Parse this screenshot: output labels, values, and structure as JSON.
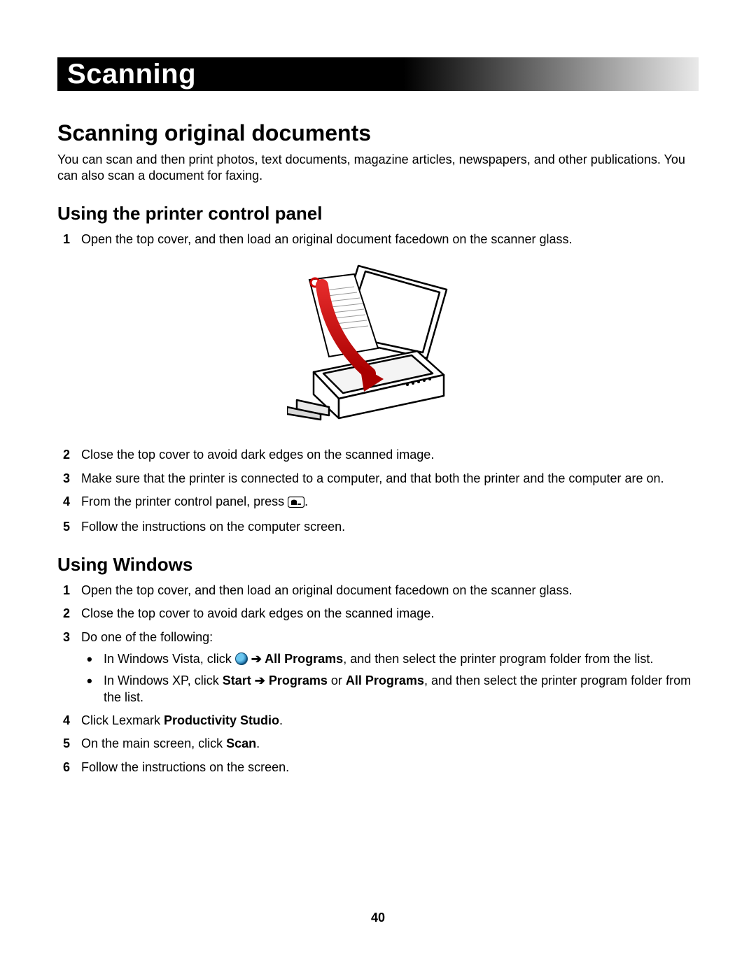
{
  "chapter_title": "Scanning",
  "section_title": "Scanning original documents",
  "intro": "You can scan and then print photos, text documents, magazine articles, newspapers, and other publications. You can also scan a document for faxing.",
  "sub1_title": "Using the printer control panel",
  "steps1": {
    "s1": "Open the top cover, and then load an original document facedown on the scanner glass.",
    "s2": "Close the top cover to avoid dark edges on the scanned image.",
    "s3": "Make sure that the printer is connected to a computer, and that both the printer and the computer are on.",
    "s4a": "From the printer control panel, press ",
    "s4b": ".",
    "s5": "Follow the instructions on the computer screen."
  },
  "sub2_title": "Using Windows",
  "steps2": {
    "s1": "Open the top cover, and then load an original document facedown on the scanner glass.",
    "s2": "Close the top cover to avoid dark edges on the scanned image.",
    "s3": "Do one of the following:",
    "b1a": "In Windows Vista, click ",
    "arrow": " ➔ ",
    "b1b_bold": "All Programs",
    "b1c": ", and then select the printer program folder from the list.",
    "b2a": "In Windows XP, click ",
    "b2b_bold": "Start",
    "b2c_bold": "Programs",
    "b2d": " or ",
    "b2e_bold": "All Programs",
    "b2f": ", and then select the printer program folder from the list.",
    "s4a": "Click Lexmark ",
    "s4b_bold": "Productivity Studio",
    "s4c": ".",
    "s5a": "On the main screen, click ",
    "s5b_bold": "Scan",
    "s5c": ".",
    "s6": "Follow the instructions on the screen."
  },
  "page_number": "40"
}
